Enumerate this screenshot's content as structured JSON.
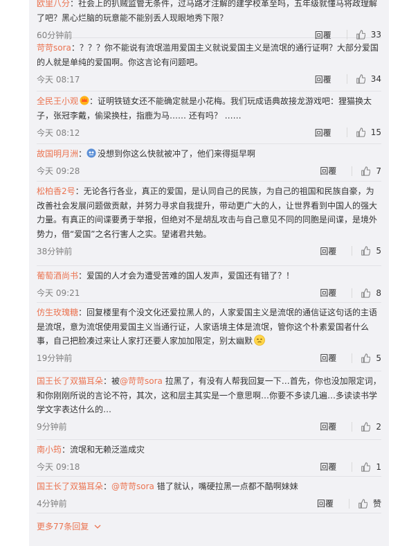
{
  "comments": [
    {
      "user": "欧里八分",
      "text": "：社会上的扒贼监管无条件，过马路才注解的建学校革至吗，五年级就懂马将政理解了吧？黑心烂脑的玩意能不能别丢人现眼地秀下限？",
      "time": "60分钟前",
      "reply": "回覆",
      "likes": "33"
    },
    {
      "user": "苛苛sora",
      "text": "：？？？你不能说有流氓滥用爱国主义就说爱国主义是流氓的通行证啊？大部分爱国的人就是单纯的爱国啊。你这言论有问题吧。",
      "time": "今天 08:17",
      "reply": "回覆",
      "likes": "34"
    },
    {
      "user": "全民王小观",
      "text": "：证明铁链女还不能确定就是小花梅。我们玩成语典故接龙游戏吧：狸猫换太子，张冠李戴，偷梁换柱，指鹿为马…… 还有吗？ ……",
      "time": "今天 08:12",
      "reply": "回覆",
      "likes": "15"
    },
    {
      "user": "故国明月洲",
      "text": "没想到你这么快就被冲了，他们来得挺早啊",
      "time": "今天 09:28",
      "reply": "回覆",
      "likes": "7"
    },
    {
      "user": "松柏香2号",
      "text": "：无论各行各业，真正的爱国，是认同自己的民族，为自己的祖国和民族自豪，为改善社会发展问题做贡献，并努力寻求自我提升，带动更广大的人，让世界看到中国人的强大力量。有真正的间谍要勇于举报，但绝对不是胡乱攻击与自己意见不同的同胞是间谍，是境外势力，借“爱国”之名行害人之实。望诸君共勉。",
      "time": "38分钟前",
      "reply": "回覆",
      "likes": "5"
    },
    {
      "user": "葡萄酒尚书",
      "text": "：爱国的人才会为遭受苦难的国人发声，爱国还有错了？！",
      "time": "今天 09:21",
      "reply": "回覆",
      "likes": "8"
    },
    {
      "user": "仿生玫瑰糖",
      "text": "：回复楼里有个没文化还爱拉黑人的，人家爱国主义是流氓的通信证这句话的主语是流氓，意为流氓使用爱国主义当通行证，人家语境主体是流氓，管你这个朴素爱国者什么事，自己把脸凑过来让人家打还要人家加加限定，别太幽默",
      "time": "19分钟前",
      "reply": "回覆",
      "likes": "5"
    },
    {
      "user": "国王长了双猫耳朵",
      "text_prefix": "：被",
      "mention": "@苛苛sora",
      "text": " 拉黑了，有没有人帮我回复一下…首先，你也没加限定词，和你刚刚所说的言论不符，其次，这和层主其实是一个意思啊…你要不多读几遍…多读读书学学文字表达什么的…",
      "time": "9分钟前",
      "reply": "回覆",
      "likes": "2"
    },
    {
      "user": "南小筠",
      "text": "：流氓和无赖泛滥成灾",
      "time": "今天 09:18",
      "reply": "回覆",
      "likes": "1"
    },
    {
      "user": "国王长了双猫耳朵",
      "text_prefix": "：",
      "mention": "@苛苛sora",
      "text": " 错了就认，嘴硬拉黑一点都不酷啊妹妹",
      "time": "4分钟前",
      "reply": "回覆",
      "likes": "赞"
    }
  ],
  "more_replies": "更多77条回复",
  "icons": {
    "like": "thumbs-up-icon",
    "expand": "chevron-down-icon",
    "badge": "crown-badge-icon",
    "avatar": "avatar-icon",
    "emoji": "smirk-emoji-icon"
  },
  "colors": {
    "username": "#eb7350",
    "panel_bg": "#f2f2f5",
    "meta": "#808080"
  }
}
